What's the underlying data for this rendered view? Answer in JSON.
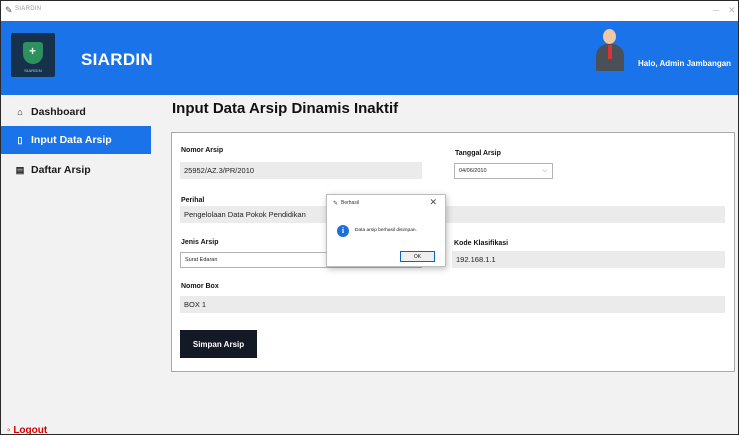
{
  "window": {
    "title": "SIARDIN",
    "minimize_glyph": "─",
    "close_glyph": "✕",
    "app_icon": "feather-icon"
  },
  "header": {
    "logo_text": "SIARDIN",
    "brand": "SIARDIN",
    "greeting": "Halo, Admin Jambangan",
    "avatar_icon": "user-avatar-icon",
    "bg_color": "#1a73e8"
  },
  "sidebar": {
    "items": [
      {
        "label": "Dashboard",
        "icon": "home-icon",
        "glyph": "⌂",
        "active": false
      },
      {
        "label": "Input Data Arsip",
        "icon": "document-icon",
        "glyph": "▯",
        "active": true
      },
      {
        "label": "Daftar Arsip",
        "icon": "list-icon",
        "glyph": "▤",
        "active": false
      }
    ],
    "logout": "◦ Logout"
  },
  "main": {
    "title": "Input Data Arsip Dinamis Inaktif",
    "form": {
      "nomor_arsip": {
        "label": "Nomor Arsip",
        "value": "25952/AZ.3/PR/2010"
      },
      "tanggal_arsip": {
        "label": "Tanggal Arsip",
        "value": "04/06/2010",
        "chevron": "⌵"
      },
      "perihal": {
        "label": "Perihal",
        "value": "Pengelolaan Data Pokok Pendidikan"
      },
      "jenis_arsip": {
        "label": "Jenis Arsip",
        "value": "Surat Edaran"
      },
      "kode_klasifikasi": {
        "label": "Kode Klasifikasi",
        "value": "192.168.1.1"
      },
      "nomor_box": {
        "label": "Nomor Box",
        "value": "BOX 1"
      },
      "save_label": "Simpan Arsip"
    }
  },
  "dialog": {
    "title": "Berhasil",
    "message": "Data arsip berhasil disimpan.",
    "ok_label": "OK",
    "close_glyph": "✕",
    "info_glyph": "i"
  }
}
